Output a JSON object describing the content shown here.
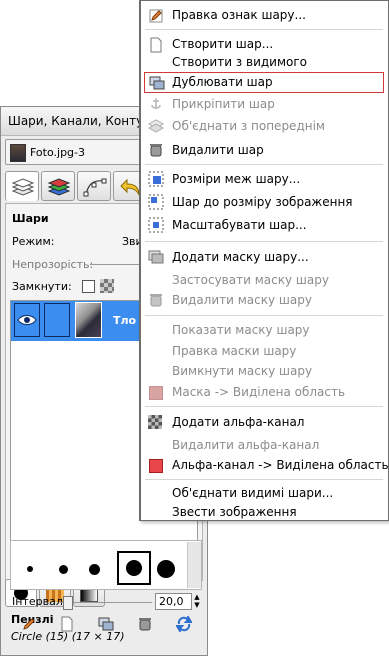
{
  "dock": {
    "title": "Шари, Канали, Контури,",
    "image_name": "Foto.jpg-3",
    "layers_title": "Шари",
    "mode_label": "Режим:",
    "mode_value": "Звичайний",
    "opacity_label": "Непрозорість:",
    "lock_label": "Замкнути:",
    "layer_name": "Тло",
    "brushes_title": "Пензлі",
    "brush_name": "Circle (15) (17 × 17)",
    "interval_label": "Інтервал:",
    "interval_value": "20,0"
  },
  "menu": {
    "items": [
      {
        "label": "Правка ознак шару...",
        "enabled": true
      },
      {
        "label": "Створити шар...",
        "enabled": true
      },
      {
        "label": "Створити з видимого",
        "enabled": true
      },
      {
        "label": "Дублювати шар",
        "enabled": true,
        "highlighted": true
      },
      {
        "label": "Прикріпити шар",
        "enabled": false
      },
      {
        "label": "Об'єднати з попереднім",
        "enabled": false
      },
      {
        "label": "Видалити шар",
        "enabled": true
      },
      {
        "label": "Розміри меж шару...",
        "enabled": true
      },
      {
        "label": "Шар до розміру зображення",
        "enabled": true
      },
      {
        "label": "Масштабувати шар...",
        "enabled": true
      },
      {
        "label": "Додати маску шару...",
        "enabled": true
      },
      {
        "label": "Застосувати маску шару",
        "enabled": false
      },
      {
        "label": "Видалити маску шару",
        "enabled": false
      },
      {
        "label": "Показати маску шару",
        "enabled": false
      },
      {
        "label": "Правка маски шару",
        "enabled": false
      },
      {
        "label": "Вимкнути маску шару",
        "enabled": false
      },
      {
        "label": "Маска -> Виділена область",
        "enabled": false
      },
      {
        "label": "Додати альфа-канал",
        "enabled": true
      },
      {
        "label": "Видалити альфа-канал",
        "enabled": false
      },
      {
        "label": "Альфа-канал -> Виділена область",
        "enabled": true
      },
      {
        "label": "Об'єднати видимі шари...",
        "enabled": true
      },
      {
        "label": "Звести зображення",
        "enabled": true
      }
    ]
  },
  "colors": {
    "selection": "#3b8df0",
    "highlight_border": "#d23a3a",
    "menu_disabled_text": "#8c8c8c"
  }
}
